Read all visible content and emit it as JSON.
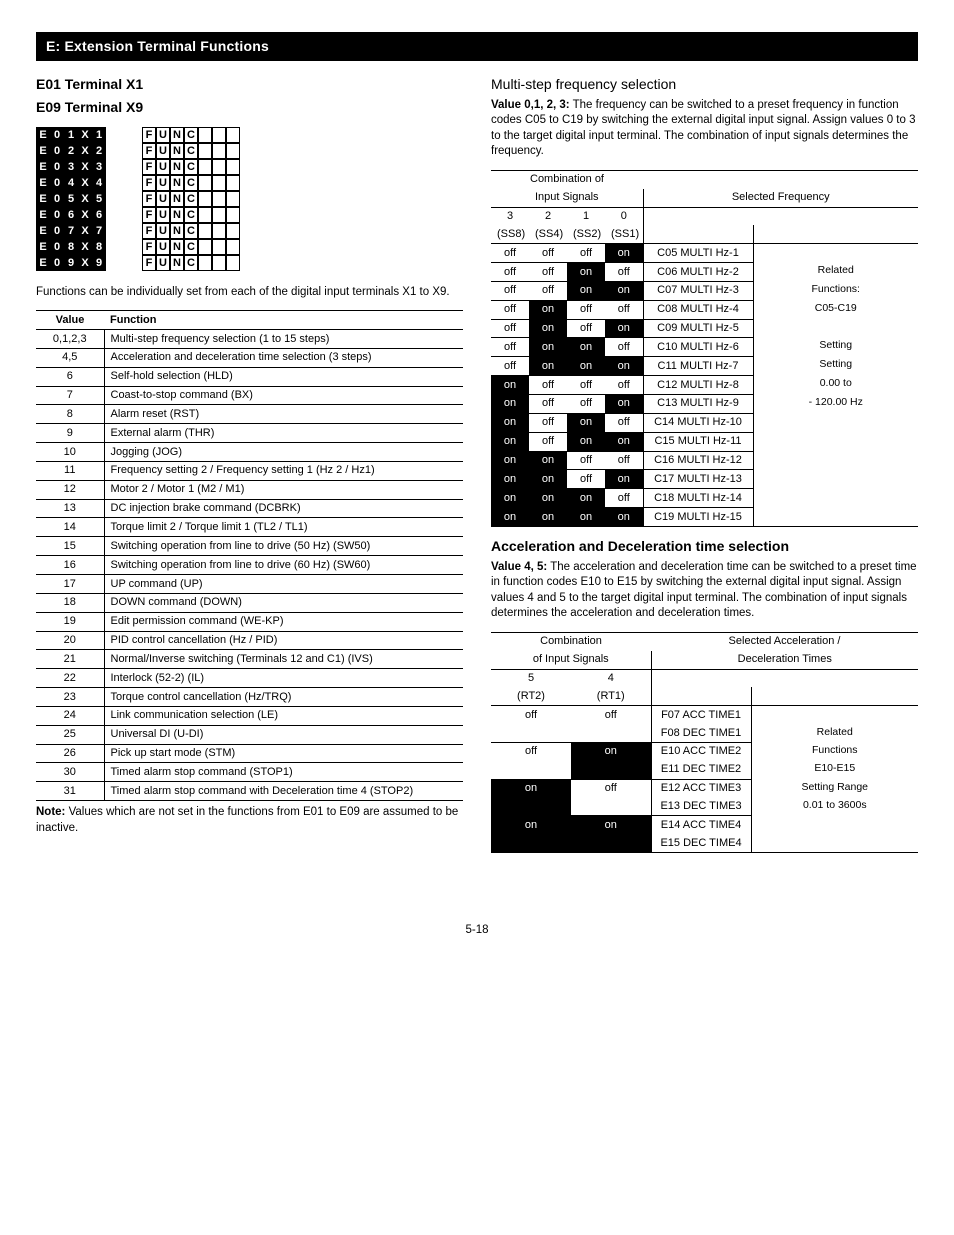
{
  "section_title": "E: Extension Terminal Functions",
  "left": {
    "h1": "E01 Terminal X1",
    "h2": "E09 Terminal X9",
    "display_rows": [
      [
        "E",
        "0",
        "1",
        "X",
        "1",
        "F",
        "U",
        "N",
        "C"
      ],
      [
        "E",
        "0",
        "2",
        "X",
        "2",
        "F",
        "U",
        "N",
        "C"
      ],
      [
        "E",
        "0",
        "3",
        "X",
        "3",
        "F",
        "U",
        "N",
        "C"
      ],
      [
        "E",
        "0",
        "4",
        "X",
        "4",
        "F",
        "U",
        "N",
        "C"
      ],
      [
        "E",
        "0",
        "5",
        "X",
        "5",
        "F",
        "U",
        "N",
        "C"
      ],
      [
        "E",
        "0",
        "6",
        "X",
        "6",
        "F",
        "U",
        "N",
        "C"
      ],
      [
        "E",
        "0",
        "7",
        "X",
        "7",
        "F",
        "U",
        "N",
        "C"
      ],
      [
        "E",
        "0",
        "8",
        "X",
        "8",
        "F",
        "U",
        "N",
        "C"
      ],
      [
        "E",
        "0",
        "9",
        "X",
        "9",
        "F",
        "U",
        "N",
        "C"
      ]
    ],
    "intro": "Functions can be individually set from each of the digital input terminals X1 to X9.",
    "table_head_value": "Value",
    "table_head_function": "Function",
    "functions": [
      {
        "v": "0,1,2,3",
        "f": "Multi-step frequency selection (1 to 15 steps)"
      },
      {
        "v": "4,5",
        "f": "Acceleration and deceleration time selection (3 steps)"
      },
      {
        "v": "6",
        "f": "Self-hold selection (HLD)"
      },
      {
        "v": "7",
        "f": "Coast-to-stop command (BX)"
      },
      {
        "v": "8",
        "f": "Alarm reset (RST)"
      },
      {
        "v": "9",
        "f": "External alarm (THR)"
      },
      {
        "v": "10",
        "f": "Jogging (JOG)"
      },
      {
        "v": "11",
        "f": "Frequency setting 2 / Frequency setting 1 (Hz 2 / Hz1)"
      },
      {
        "v": "12",
        "f": "Motor 2 / Motor 1 (M2 / M1)"
      },
      {
        "v": "13",
        "f": "DC injection brake command (DCBRK)"
      },
      {
        "v": "14",
        "f": "Torque limit 2 / Torque limit 1 (TL2 / TL1)"
      },
      {
        "v": "15",
        "f": "Switching operation from line to drive (50 Hz) (SW50)"
      },
      {
        "v": "16",
        "f": "Switching operation from line to drive (60 Hz) (SW60)"
      },
      {
        "v": "17",
        "f": "UP command (UP)"
      },
      {
        "v": "18",
        "f": "DOWN command (DOWN)"
      },
      {
        "v": "19",
        "f": "Edit permission command (WE-KP)"
      },
      {
        "v": "20",
        "f": "PID control cancellation (Hz / PID)"
      },
      {
        "v": "21",
        "f": "Normal/Inverse switching (Terminals 12 and C1) (IVS)"
      },
      {
        "v": "22",
        "f": "Interlock (52-2) (IL)"
      },
      {
        "v": "23",
        "f": "Torque control cancellation (Hz/TRQ)"
      },
      {
        "v": "24",
        "f": "Link communication selection (LE)"
      },
      {
        "v": "25",
        "f": "Universal DI (U-DI)"
      },
      {
        "v": "26",
        "f": "Pick up start mode (STM)"
      },
      {
        "v": "30",
        "f": "Timed alarm stop command (STOP1)"
      },
      {
        "v": "31",
        "f": "Timed alarm stop command with Deceleration time 4 (STOP2)"
      }
    ],
    "note_label": "Note:",
    "note_body": " Values which are not set in the functions from E01 to E09 are assumed to be inactive."
  },
  "right": {
    "h1": "Multi-step frequency selection",
    "intro_label": "Value 0,1, 2, 3:",
    "intro_body": " The frequency can be switched to a preset frequency in function codes C05 to C19 by switching the external digital input signal.  Assign values 0 to 3 to the target digital input terminal.  The combination of input signals determines the frequency.",
    "freq_head_combo1": "Combination of",
    "freq_head_combo2": "Input Signals",
    "freq_head_selected": "Selected Frequency",
    "freq_cols": {
      "c3": "3",
      "c2": "2",
      "c1": "1",
      "c0": "0",
      "s3": "(SS8)",
      "s2": "(SS4)",
      "s1": "(SS2)",
      "s0": "(SS1)"
    },
    "freq_rows": [
      {
        "a": "off",
        "b": "off",
        "c": "off",
        "d": "on",
        "sel": "C05 MULTI Hz-1"
      },
      {
        "a": "off",
        "b": "off",
        "c": "on",
        "d": "off",
        "sel": "C06 MULTI Hz-2"
      },
      {
        "a": "off",
        "b": "off",
        "c": "on",
        "d": "on",
        "sel": "C07 MULTI Hz-3"
      },
      {
        "a": "off",
        "b": "on",
        "c": "off",
        "d": "off",
        "sel": "C08 MULTI Hz-4"
      },
      {
        "a": "off",
        "b": "on",
        "c": "off",
        "d": "on",
        "sel": "C09 MULTI Hz-5"
      },
      {
        "a": "off",
        "b": "on",
        "c": "on",
        "d": "off",
        "sel": "C10 MULTI Hz-6"
      },
      {
        "a": "off",
        "b": "on",
        "c": "on",
        "d": "on",
        "sel": "C11 MULTI Hz-7"
      },
      {
        "a": "on",
        "b": "off",
        "c": "off",
        "d": "off",
        "sel": "C12 MULTI Hz-8"
      },
      {
        "a": "on",
        "b": "off",
        "c": "off",
        "d": "on",
        "sel": "C13 MULTI Hz-9"
      },
      {
        "a": "on",
        "b": "off",
        "c": "on",
        "d": "off",
        "sel": "C14 MULTI Hz-10"
      },
      {
        "a": "on",
        "b": "off",
        "c": "on",
        "d": "on",
        "sel": "C15 MULTI Hz-11"
      },
      {
        "a": "on",
        "b": "on",
        "c": "off",
        "d": "off",
        "sel": "C16 MULTI Hz-12"
      },
      {
        "a": "on",
        "b": "on",
        "c": "off",
        "d": "on",
        "sel": "C17 MULTI Hz-13"
      },
      {
        "a": "on",
        "b": "on",
        "c": "on",
        "d": "off",
        "sel": "C18 MULTI Hz-14"
      },
      {
        "a": "on",
        "b": "on",
        "c": "on",
        "d": "on",
        "sel": "C19 MULTI Hz-15"
      }
    ],
    "freq_side": [
      "Related",
      "Functions:",
      "C05-C19",
      "",
      "Setting",
      "Setting",
      "0.00 to",
      "- 120.00 Hz"
    ],
    "acc_h": "Acceleration and Deceleration time selection",
    "acc_intro_label": "Value 4, 5:",
    "acc_intro_body": " The acceleration and deceleration time can be switched to a preset time in function codes E10 to E15 by switching the external digital input signal.  Assign values 4 and 5 to the target digital input terminal.  The combination of input signals determines the acceleration and deceleration times.",
    "acc_head_combo1": "Combination",
    "acc_head_combo2": "of Input Signals",
    "acc_head_sel1": "Selected Acceleration /",
    "acc_head_sel2": "Deceleration Times",
    "acc_cols": {
      "c5": "5",
      "c4": "4",
      "s5": "(RT2)",
      "s4": "(RT1)"
    },
    "acc_rows": [
      {
        "a": "off",
        "b": "off",
        "sel1": "F07 ACC TIME1",
        "sel2": "F08 DEC TIME1"
      },
      {
        "a": "off",
        "b": "on",
        "sel1": "E10 ACC TIME2",
        "sel2": "E11 DEC TIME2"
      },
      {
        "a": "on",
        "b": "off",
        "sel1": "E12 ACC TIME3",
        "sel2": "E13 DEC TIME3"
      },
      {
        "a": "on",
        "b": "on",
        "sel1": "E14 ACC TIME4",
        "sel2": "E15 DEC TIME4"
      }
    ],
    "acc_side": [
      "",
      "Related",
      "Functions",
      "E10-E15",
      "Setting Range",
      "0.01 to 3600s"
    ]
  },
  "page_number": "5-18"
}
